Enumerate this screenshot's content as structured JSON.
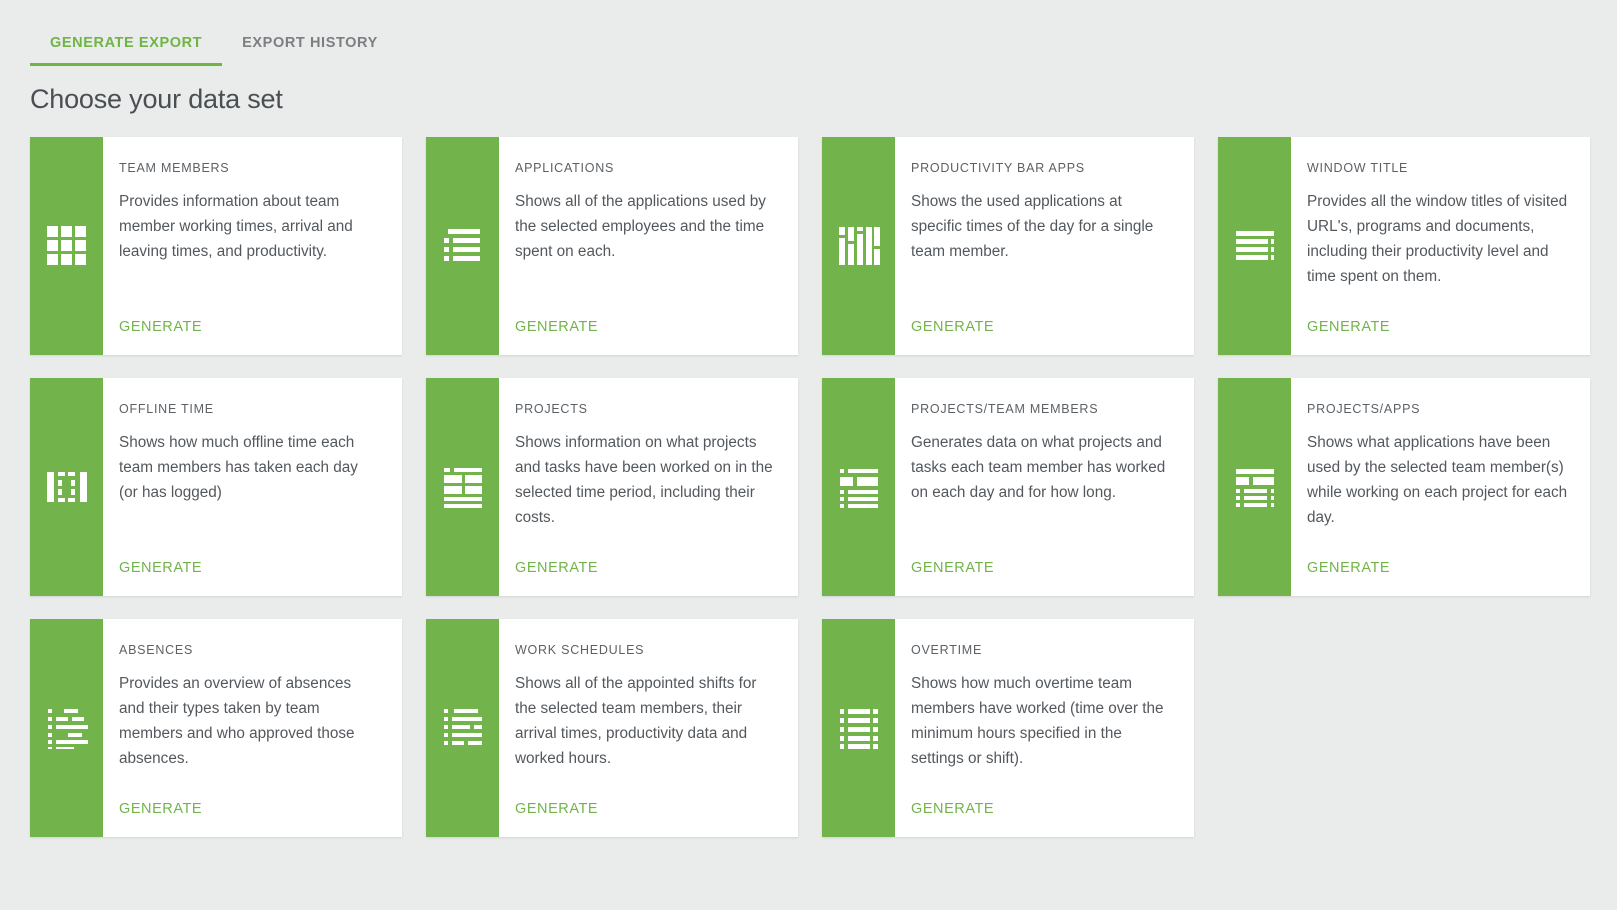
{
  "tabs": [
    {
      "label": "GENERATE EXPORT",
      "active": true
    },
    {
      "label": "EXPORT HISTORY",
      "active": false
    }
  ],
  "page": {
    "title": "Choose your data set",
    "accent_green": "#72b44b",
    "background": "#eaebeb",
    "card_background": "#ffffff",
    "title_color": "#4a4f54"
  },
  "generate_label": "GENERATE",
  "cards": [
    {
      "title": "TEAM MEMBERS",
      "description": "Provides information about team member working times, arrival and leaving times, and productivity.",
      "action": "GENERATE",
      "icon": "grid-3x3-icon"
    },
    {
      "title": "APPLICATIONS",
      "description": "Shows all of the applications used by the selected employees and the time spent on each.",
      "action": "GENERATE",
      "icon": "list-rows-icon"
    },
    {
      "title": "PRODUCTIVITY BAR APPS",
      "description": "Shows the used applications at specific times of the day for a single team member.",
      "action": "GENERATE",
      "icon": "vertical-bars-icon"
    },
    {
      "title": "WINDOW TITLE",
      "description": "Provides all the window titles of visited URL's, programs and documents, including their productivity level and time spent on them.",
      "action": "GENERATE",
      "icon": "stacked-lines-icon"
    },
    {
      "title": "OFFLINE TIME",
      "description": "Shows how much offline time each team members has taken each day (or has logged)",
      "action": "GENERATE",
      "icon": "offline-gap-icon"
    },
    {
      "title": "PROJECTS",
      "description": "Shows information on what projects and tasks have been worked on in the selected time period, including their costs.",
      "action": "GENERATE",
      "icon": "table-grid-icon"
    },
    {
      "title": "PROJECTS/TEAM MEMBERS",
      "description": "Generates data on what projects and tasks each team member has worked on each day and for how long.",
      "action": "GENERATE",
      "icon": "list-header-icon"
    },
    {
      "title": "PROJECTS/APPS",
      "description": "Shows what applications have been used by the selected team member(s) while working on each project for each day.",
      "action": "GENERATE",
      "icon": "list-split-icon"
    },
    {
      "title": "ABSENCES",
      "description": "Provides an overview of absences and their types taken by team members and who approved those absences.",
      "action": "GENERATE",
      "icon": "gantt-bars-icon"
    },
    {
      "title": "WORK SCHEDULES",
      "description": "Shows all of the appointed shifts for the selected team members, their arrival times, productivity data and worked hours.",
      "action": "GENERATE",
      "icon": "schedule-rows-icon"
    },
    {
      "title": "OVERTIME",
      "description": "Shows how much overtime team members have worked (time over the minimum hours specified in the settings or shift).",
      "action": "GENERATE",
      "icon": "overtime-rows-icon"
    }
  ]
}
